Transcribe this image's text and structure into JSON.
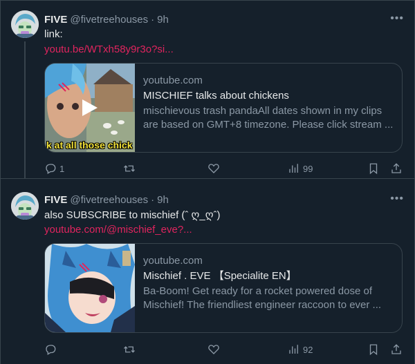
{
  "tweets": [
    {
      "author": {
        "name": "FIVE",
        "handle": "@fivetreehouses",
        "time": "9h"
      },
      "text": "link:",
      "link_text": "youtu.be/WTxh58y9r3o?si...",
      "card": {
        "domain": "youtube.com",
        "title": "MISCHIEF talks about chickens",
        "description_line1": "mischievous trash pandaAll dates shown in my clips",
        "description_line2": "are based on GMT+8 timezone. Please click stream ...",
        "thumb_caption": "k at all those chick"
      },
      "stats": {
        "replies": "1",
        "retweets": "",
        "likes": "",
        "views": "99"
      }
    },
    {
      "author": {
        "name": "FIVE",
        "handle": "@fivetreehouses",
        "time": "9h"
      },
      "text": "also SUBSCRIBE to mischief (ˆ ღ_ღˆ)",
      "link_text": "youtube.com/@mischief_eve?...",
      "card": {
        "domain": "youtube.com",
        "title": "Mischief . EVE 【Specialite EN】",
        "description_line1": "Ba-Boom! Get ready for a rocket powered dose of",
        "description_line2": "Mischief! The friendliest engineer raccoon to ever ..."
      },
      "stats": {
        "replies": "",
        "retweets": "",
        "likes": "",
        "views": "92"
      }
    }
  ],
  "colors": {
    "background": "#15202b",
    "link": "#e0245e",
    "muted": "#8b98a5",
    "border": "#38444d"
  },
  "icons": [
    "more-icon",
    "reply-icon",
    "retweet-icon",
    "like-icon",
    "views-icon",
    "bookmark-icon",
    "share-icon",
    "play-icon"
  ]
}
